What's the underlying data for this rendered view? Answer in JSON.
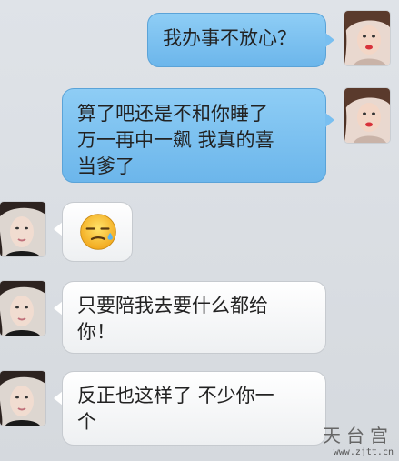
{
  "messages": [
    {
      "side": "right",
      "text": "我办事不放心？"
    },
    {
      "side": "right",
      "text": "算了吧还是不和你睡了\n万一再中一飙  我真的喜\n当爹了"
    },
    {
      "side": "left",
      "emoji": "sweat-expressionless-emoji"
    },
    {
      "side": "left",
      "text": "只要陪我去要什么都给\n你！"
    },
    {
      "side": "left",
      "text": "反正也这样了  不少你一\n个"
    }
  ],
  "watermark": {
    "logo": "天台宫",
    "url": "www.zjtt.cn"
  },
  "colors": {
    "outgoing_bubble": "#7ec2f0",
    "incoming_bubble": "#ffffff",
    "background": "#dadee3"
  }
}
